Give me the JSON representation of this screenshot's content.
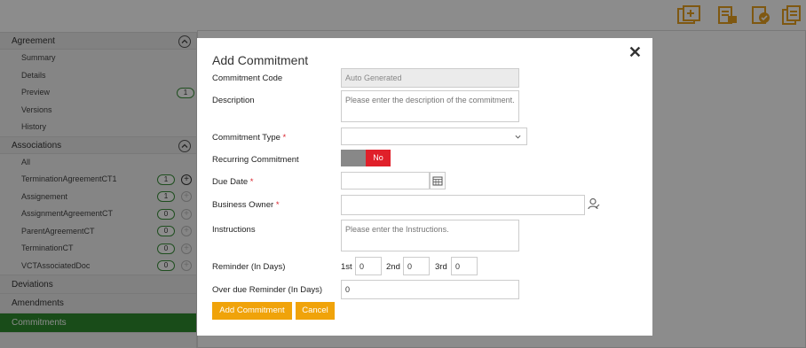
{
  "toolbar": {
    "icons": [
      "import-icon",
      "new-document-icon",
      "approve-icon",
      "copy-icon"
    ],
    "color": "#e8a020"
  },
  "sidebar": {
    "agreement": {
      "title": "Agreement",
      "items": [
        {
          "label": "Summary"
        },
        {
          "label": "Details"
        },
        {
          "label": "Preview",
          "badge": "1"
        },
        {
          "label": "Versions"
        },
        {
          "label": "History"
        }
      ]
    },
    "associations": {
      "title": "Associations",
      "items": [
        {
          "label": "All"
        },
        {
          "label": "TerminationAgreementCT1",
          "badge": "1"
        },
        {
          "label": "Assignement",
          "badge": "1"
        },
        {
          "label": "AssignmentAgreementCT",
          "badge": "0"
        },
        {
          "label": "ParentAgreementCT",
          "badge": "0"
        },
        {
          "label": "TerminationCT",
          "badge": "0"
        },
        {
          "label": "VCTAssociatedDoc",
          "badge": "0"
        }
      ]
    },
    "deviations": "Deviations",
    "amendments": "Amendments",
    "commitments": "Commitments"
  },
  "modal": {
    "title": "Add Commitment",
    "close": "✕",
    "fields": {
      "code_label": "Commitment Code",
      "code_value": "Auto Generated",
      "description_label": "Description",
      "description_placeholder": "Please enter the description of the commitment.",
      "type_label": "Commitment Type",
      "type_value": "",
      "recurring_label": "Recurring Commitment",
      "recurring_value": "No",
      "due_label": "Due Date",
      "due_value": "",
      "owner_label": "Business Owner",
      "owner_value": "",
      "instructions_label": "Instructions",
      "instructions_placeholder": "Please enter the Instructions.",
      "reminder_label": "Reminder (In Days)",
      "reminder_1st_label": "1st",
      "reminder_1st_value": "0",
      "reminder_2nd_label": "2nd",
      "reminder_2nd_value": "0",
      "reminder_3rd_label": "3rd",
      "reminder_3rd_value": "0",
      "overdue_label": "Over due Reminder (In Days)",
      "overdue_value": "0",
      "required_mark": "*"
    },
    "buttons": {
      "add": "Add Commitment",
      "cancel": "Cancel"
    }
  },
  "colors": {
    "accent": "#f0a30a",
    "active_nav": "#2e8a2e",
    "toggle_no": "#e0202a"
  }
}
